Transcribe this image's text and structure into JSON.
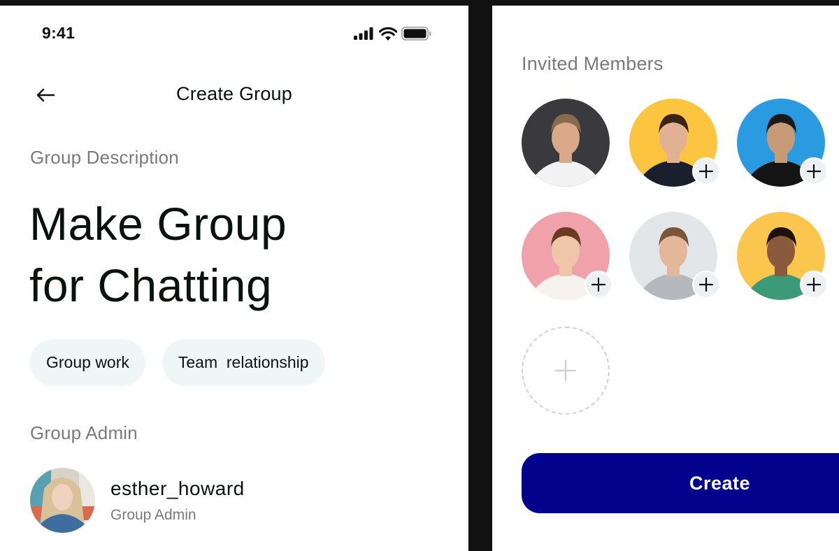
{
  "status_bar": {
    "time": "9:41",
    "icons": [
      "cellular-signal-icon",
      "wifi-icon",
      "battery-icon"
    ]
  },
  "header": {
    "back_icon": "arrow-left-icon",
    "title": "Create Group"
  },
  "description": {
    "label": "Group Description",
    "title_line1": "Make Group",
    "title_line2": "for Chatting"
  },
  "tags": [
    {
      "label": "Group work"
    },
    {
      "label": "Team  relationship"
    }
  ],
  "admin": {
    "label": "Group Admin",
    "username": "esther_howard",
    "role": "Group Admin"
  },
  "invited": {
    "label": "Invited Members",
    "members": [
      {
        "bg": "#3a3a3e",
        "skin": "#d9a98a",
        "hair": "#8a6a4c",
        "shirt": "#f2f2f2",
        "has_add": false
      },
      {
        "bg": "#fcc53f",
        "skin": "#e0b293",
        "hair": "#3b2416",
        "shirt": "#1a1f2e",
        "has_add": true
      },
      {
        "bg": "#2a9be0",
        "skin": "#c79a78",
        "hair": "#1a1a1a",
        "shirt": "#151515",
        "has_add": true
      },
      {
        "bg": "#f0a1aa",
        "skin": "#f0c6ab",
        "hair": "#6a3a22",
        "shirt": "#f6f3ef",
        "has_add": true
      },
      {
        "bg": "#e3e6e9",
        "skin": "#e2b899",
        "hair": "#7a5536",
        "shirt": "#b5b8bd",
        "has_add": true
      },
      {
        "bg": "#fbc64e",
        "skin": "#8a5a3e",
        "hair": "#1b120c",
        "shirt": "#3c9a78",
        "has_add": true
      }
    ],
    "add_slot_icon": "plus-icon"
  },
  "actions": {
    "create_label": "Create"
  },
  "colors": {
    "primary": "#03028c",
    "tag_bg": "#eef7f6",
    "muted_text": "#7a7a7a"
  }
}
